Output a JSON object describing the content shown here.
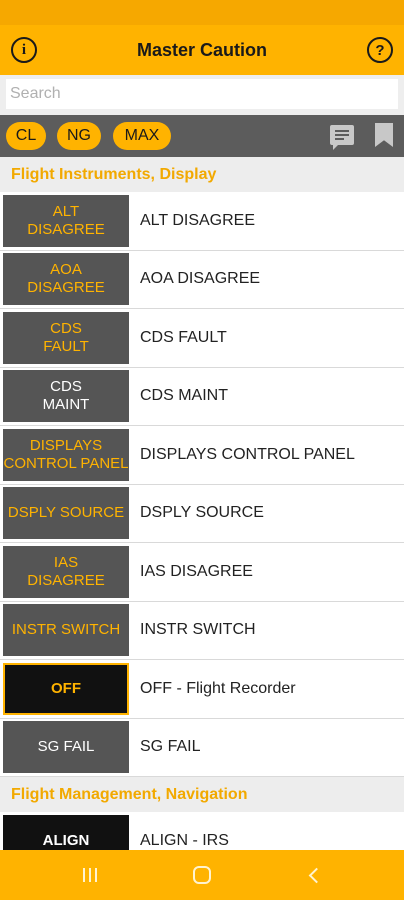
{
  "app_bar": {
    "title": "Master Caution",
    "info_icon": "info-icon",
    "help_icon": "help-icon"
  },
  "search": {
    "placeholder": "Search",
    "value": ""
  },
  "filters": {
    "cl": "CL",
    "ng": "NG",
    "max": "MAX"
  },
  "toolbar_icons": [
    "notes-icon",
    "bookmark-icon"
  ],
  "colors": {
    "accent": "#ffb300",
    "header_text": "#f2a900",
    "badge_bg": "#555555"
  },
  "sections": [
    {
      "title": "Flight Instruments, Display",
      "items": [
        {
          "badge": "ALT\nDISAGREE",
          "label": "ALT DISAGREE"
        },
        {
          "badge": "AOA\nDISAGREE",
          "label": "AOA DISAGREE"
        },
        {
          "badge": "CDS\nFAULT",
          "label": "CDS FAULT"
        },
        {
          "badge": "CDS\nMAINT",
          "label": "CDS MAINT"
        },
        {
          "badge": "DISPLAYS\nCONTROL PANEL",
          "label": "DISPLAYS CONTROL PANEL"
        },
        {
          "badge": "DSPLY SOURCE",
          "label": "DSPLY SOURCE"
        },
        {
          "badge": "IAS\nDISAGREE",
          "label": "IAS DISAGREE"
        },
        {
          "badge": "INSTR SWITCH",
          "label": "INSTR SWITCH"
        },
        {
          "badge": "OFF",
          "label": "OFF - Flight Recorder"
        },
        {
          "badge": "SG FAIL",
          "label": "SG FAIL"
        }
      ]
    },
    {
      "title": "Flight Management, Navigation",
      "items": [
        {
          "badge": "ALIGN",
          "label": "ALIGN - IRS"
        }
      ]
    }
  ],
  "nav_bar": {
    "recents_icon": "recents-icon",
    "home_icon": "home-icon",
    "back_icon": "back-icon"
  }
}
